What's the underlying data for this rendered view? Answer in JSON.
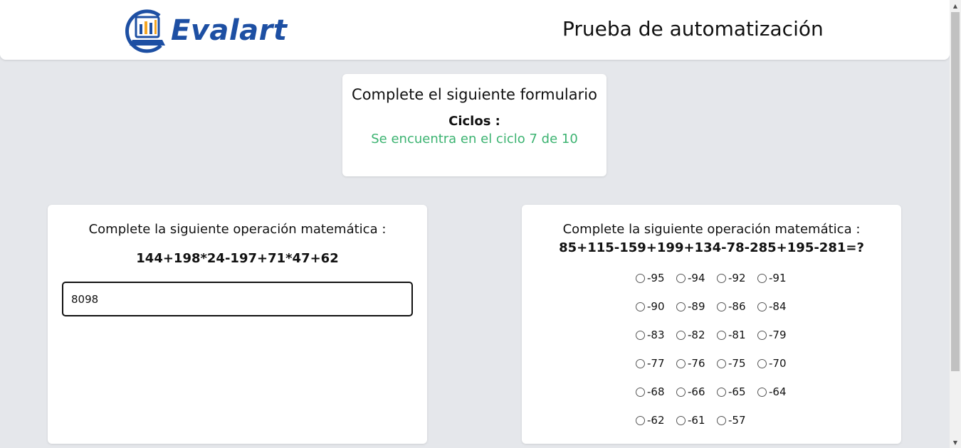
{
  "header": {
    "logo_text": "Evalart",
    "title": "Prueba de automatización"
  },
  "cycle_card": {
    "title": "Complete el siguiente formulario",
    "label": "Ciclos :",
    "status": "Se encuentra en el ciclo 7 de 10",
    "status_color": "#3cb371"
  },
  "left_question": {
    "prompt": "Complete la siguiente operación matemática :",
    "expression": "144+198*24-197+71*47+62",
    "answer_value": "8098"
  },
  "right_question": {
    "prompt": "Complete la siguiente operación matemática :",
    "expression": "85+115-159+199+134-78-285+195-281=?",
    "options": [
      "-95",
      "-94",
      "-92",
      "-91",
      "-90",
      "-89",
      "-86",
      "-84",
      "-83",
      "-82",
      "-81",
      "-79",
      "-77",
      "-76",
      "-75",
      "-70",
      "-68",
      "-66",
      "-65",
      "-64",
      "-62",
      "-61",
      "-57"
    ]
  },
  "colors": {
    "background": "#e5e7eb",
    "brand": "#1d4fa3",
    "logo_accent": "#f5a623"
  }
}
